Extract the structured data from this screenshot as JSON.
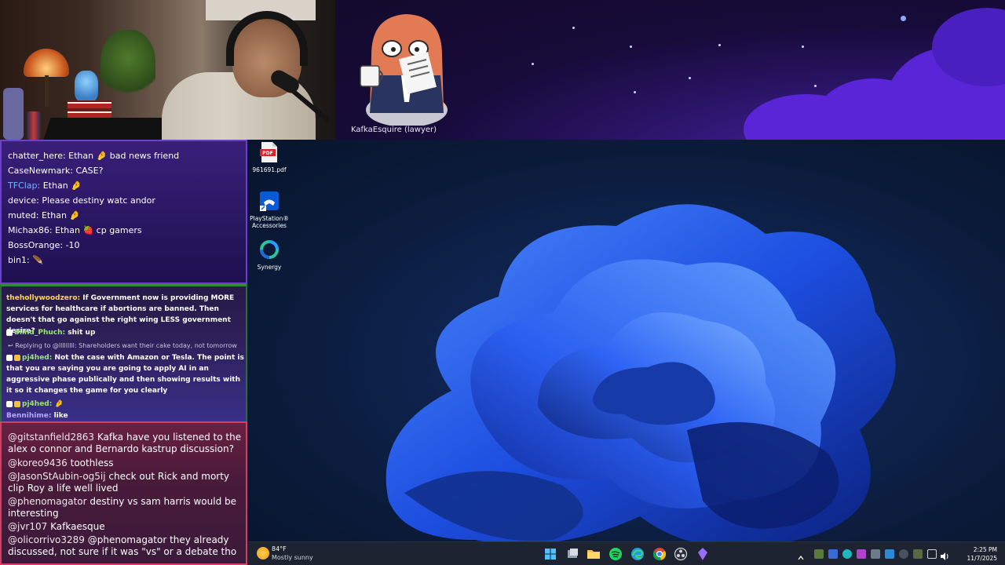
{
  "banner": {
    "caption": "KafkaEsquire (lawyer)"
  },
  "desktop": {
    "icons": [
      {
        "label": "961691.pdf",
        "icon": "pdf-file-icon"
      },
      {
        "label": "PlayStation® Accessories",
        "icon": "playstation-accessories-icon"
      },
      {
        "label": "Synergy",
        "icon": "synergy-icon"
      }
    ]
  },
  "chat_top": [
    {
      "user": "chatter_here:",
      "text": " Ethan 🤌 bad news friend",
      "user_color": "#ffffff"
    },
    {
      "user": "CaseNewmark:",
      "text": " CASE?",
      "user_color": "#ffffff"
    },
    {
      "user": "TFClap:",
      "text": " Ethan 🤌",
      "user_color": "#6fb8ff"
    },
    {
      "user": "device:",
      "text": " Please destiny watc andor",
      "user_color": "#ffffff"
    },
    {
      "user": "muted:",
      "text": " Ethan 🤌",
      "user_color": "#ffffff"
    },
    {
      "user": "Michax86:",
      "text": " Ethan 🍓 cp gamers",
      "user_color": "#ffffff"
    },
    {
      "user": "BossOrange:",
      "text": " -10",
      "user_color": "#ffffff"
    },
    {
      "user": "bin1:",
      "text": " 🪶",
      "user_color": "#ffffff"
    }
  ],
  "chat_mid": {
    "m1_user": "thehollywoodzero:",
    "m1_text": " If Government now is providing MORE services for healthcare if abortions are banned. Then doesn't that go against the right wing LESS government desire?",
    "m2_user": "Blind_Phuch:",
    "m2_text": " shit up",
    "reply": "↩ Replying to @lllllllll: Shareholders want their cake today, not tomorrow",
    "m3_user": "pj4hed:",
    "m3_text": " Not the case with Amazon or Tesla. The point is that you are saying you are going to apply AI in an aggressive phase publically and then showing results with it so it changes the game for you clearly",
    "m4_user": "pj4hed:",
    "m4_text": " 🤌",
    "m5_user": "Bennihime:",
    "m5_text": " like"
  },
  "chat_bottom": [
    {
      "user": "@gitstanfield2863",
      "text": " Kafka have you listened to the alex o connor and Bernardo kastrup discussion?"
    },
    {
      "user": "@koreo9436",
      "text": " toothless"
    },
    {
      "user": "@JasonStAubin-og5ij",
      "text": " check out Rick and morty clip Roy a life well lived"
    },
    {
      "user": "@phenomagator",
      "text": " destiny vs sam harris would be interesting"
    },
    {
      "user": "@jvr107",
      "text": " Kafkaesque"
    },
    {
      "user": "@olicorrivo3289",
      "text": " @phenomagator they already discussed, not sure if it was \"vs\" or a debate tho"
    }
  ],
  "taskbar": {
    "temp": "84°F",
    "condition": "Mostly sunny",
    "time": "2:25 PM",
    "date": "11/7/2025"
  },
  "colors": {
    "accent": "#0067c0",
    "chat_top_border": "#6d3fd0",
    "chat_bottom_border": "#d04060"
  }
}
